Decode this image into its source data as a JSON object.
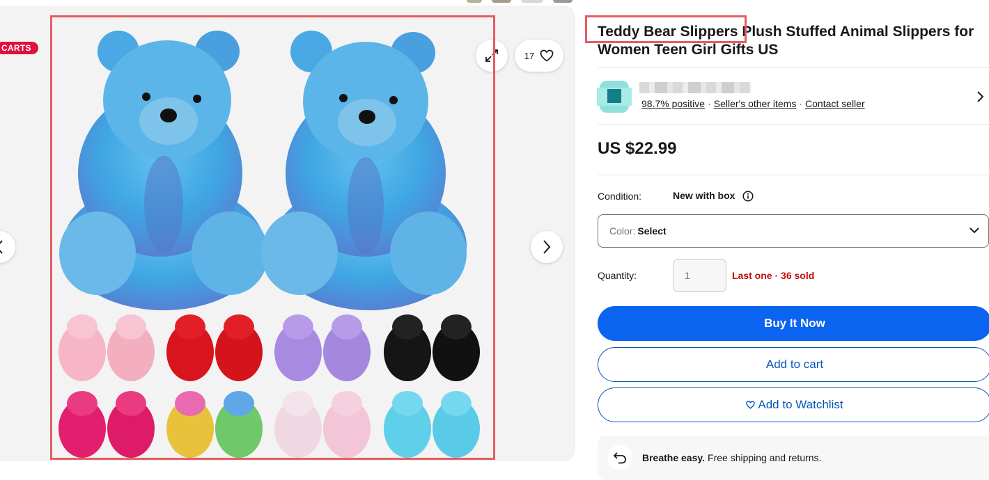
{
  "gallery": {
    "badge": "CARTS",
    "watch_count": "17"
  },
  "listing": {
    "title": "Teddy Bear Slippers Plush Stuffed Animal Slippers for Women Teen Girl Gifts US",
    "price": "US $22.99"
  },
  "seller": {
    "feedback": "98.7% positive",
    "other_items": "Seller's other items",
    "contact": "Contact seller"
  },
  "condition": {
    "label": "Condition:",
    "value": "New with box"
  },
  "variation": {
    "label": "Color:",
    "value": "Select"
  },
  "quantity": {
    "label": "Quantity:",
    "placeholder": "1",
    "availability": "Last one",
    "separator": "·",
    "sold": "36 sold"
  },
  "actions": {
    "buy_now": "Buy It Now",
    "add_to_cart": "Add to cart",
    "add_to_watchlist": "Add to Watchlist"
  },
  "assurance": {
    "strong": "Breathe easy.",
    "text": "Free shipping and returns."
  },
  "colors": {
    "primary_blue": "#0a64f0",
    "link_blue": "#0654ba",
    "alert_red": "#c00d0d",
    "badge_red": "#e0103a",
    "highlight": "#e45e62"
  }
}
